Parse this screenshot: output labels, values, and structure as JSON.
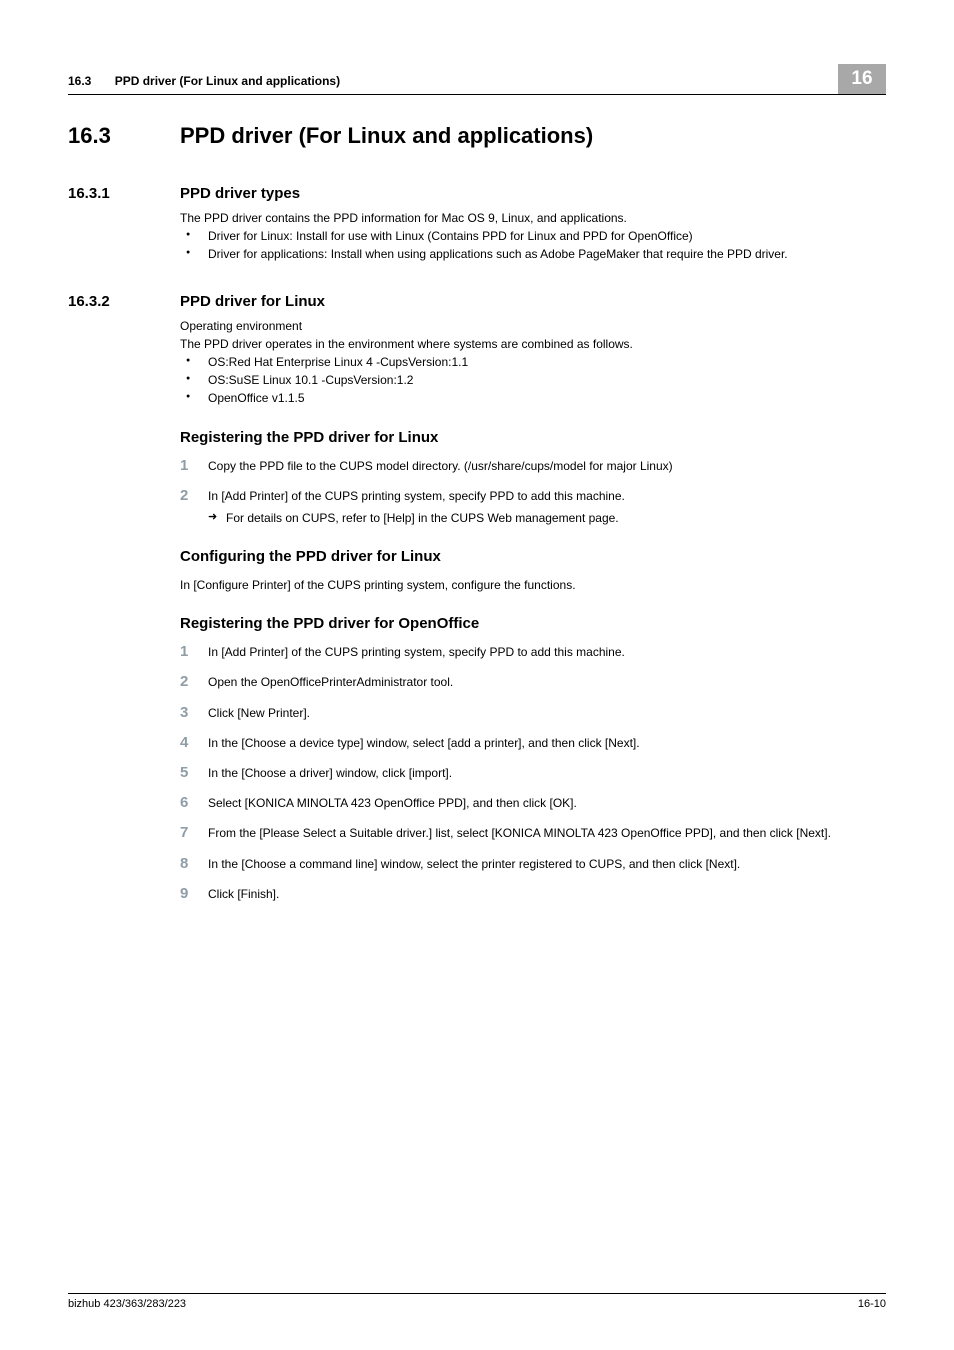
{
  "header": {
    "section_num": "16.3",
    "section_title": "PPD driver (For Linux and applications)",
    "chapter_badge": "16"
  },
  "h1": {
    "num": "16.3",
    "text": "PPD driver (For Linux and applications)"
  },
  "s1": {
    "num": "16.3.1",
    "title": "PPD driver types",
    "intro": "The PPD driver contains the PPD information for Mac OS 9, Linux, and applications.",
    "bullets": [
      "Driver for Linux: Install for use with Linux (Contains PPD for Linux and PPD for OpenOffice)",
      "Driver for applications: Install when using applications such as Adobe PageMaker that require the PPD driver."
    ]
  },
  "s2": {
    "num": "16.3.2",
    "title": "PPD driver for Linux",
    "env_label": "Operating environment",
    "env_intro": "The PPD driver operates in the environment where systems are combined as follows.",
    "env_bullets": [
      "OS:Red Hat Enterprise Linux 4 -CupsVersion:1.1",
      "OS:SuSE Linux 10.1 -CupsVersion:1.2",
      "OpenOffice v1.1.5"
    ],
    "h3a": "Registering the PPD driver for Linux",
    "steps_a": [
      {
        "text": "Copy the PPD file to the CUPS model directory. (/usr/share/cups/model for major Linux)"
      },
      {
        "text": "In [Add Printer] of the CUPS printing system, specify PPD to add this machine.",
        "sub": "For details on CUPS, refer to [Help] in the CUPS Web management page."
      }
    ],
    "h3b": "Configuring the PPD driver for Linux",
    "conf_text": "In [Configure Printer] of the CUPS printing system, configure the functions.",
    "h3c": "Registering the PPD driver for OpenOffice",
    "steps_c": [
      {
        "text": "In [Add Printer] of the CUPS printing system, specify PPD to add this machine."
      },
      {
        "text": "Open the OpenOfficePrinterAdministrator tool."
      },
      {
        "text": "Click [New Printer]."
      },
      {
        "text": "In the [Choose a device type] window, select [add a printer], and then click [Next]."
      },
      {
        "text": "In the [Choose a driver] window, click [import]."
      },
      {
        "text": "Select [KONICA MINOLTA 423 OpenOffice PPD], and then click [OK]."
      },
      {
        "text": "From the [Please Select a Suitable driver.] list, select [KONICA MINOLTA 423 OpenOffice PPD], and then click [Next]."
      },
      {
        "text": "In the [Choose a command line] window, select the printer registered to CUPS, and then click [Next]."
      },
      {
        "text": "Click [Finish]."
      }
    ]
  },
  "footer": {
    "left": "bizhub 423/363/283/223",
    "right": "16-10"
  }
}
